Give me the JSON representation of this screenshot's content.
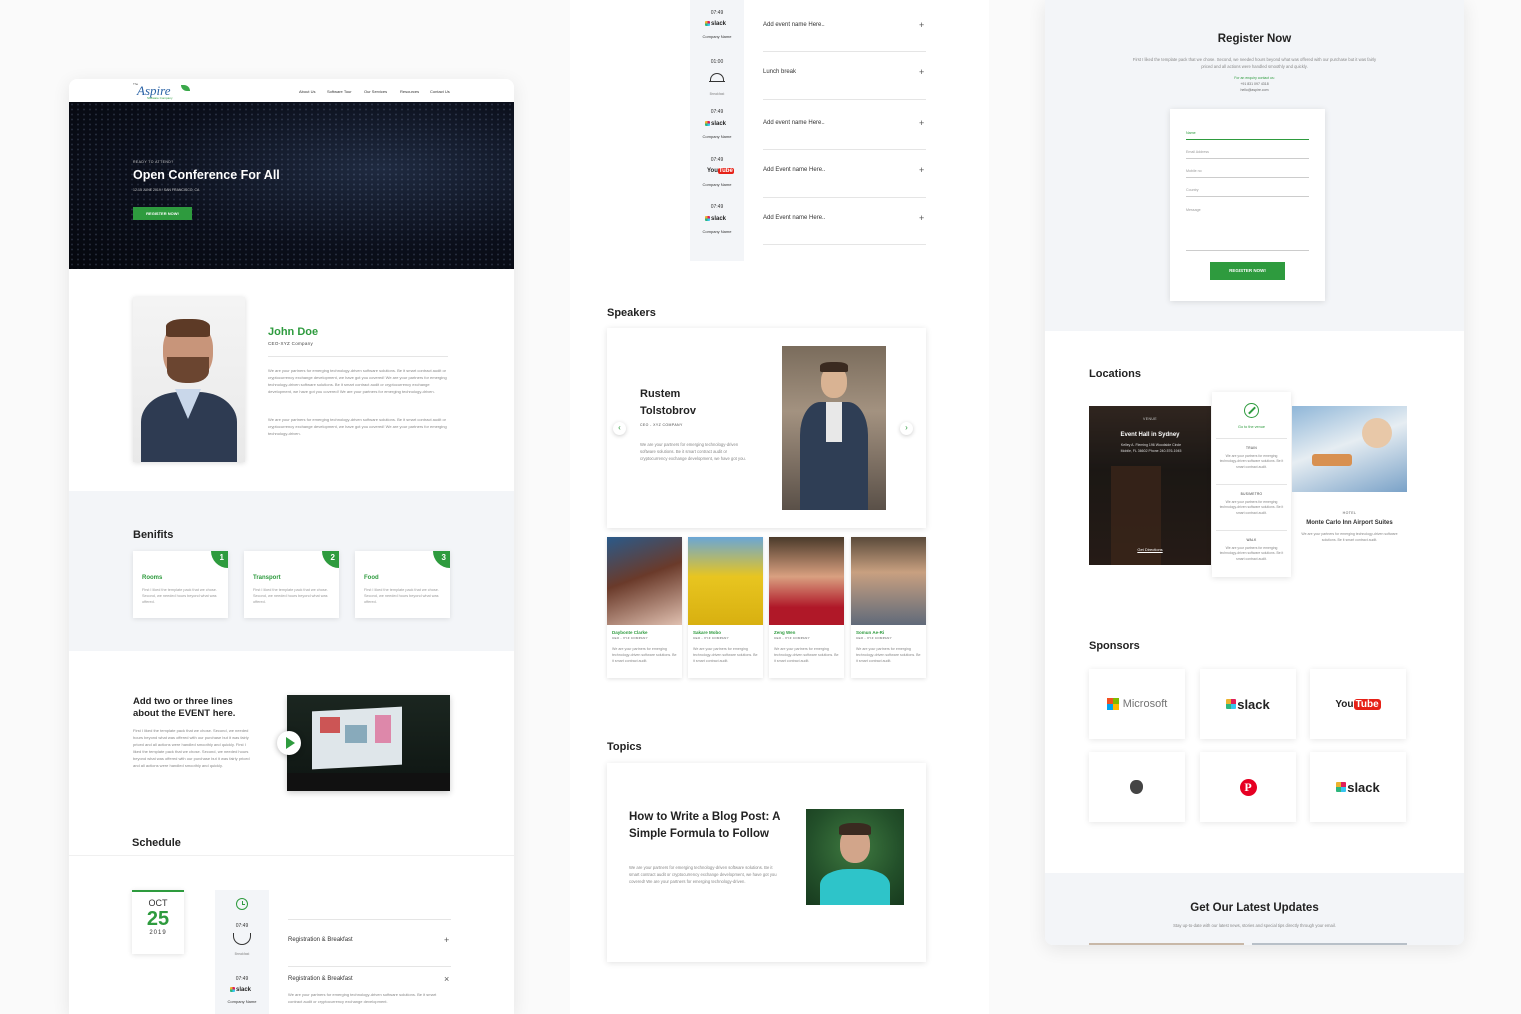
{
  "page1": {
    "logo_small": "The",
    "logo": "Aspire",
    "logo_tag": "Software Company",
    "nav": [
      "About Us",
      "Software Tour",
      "Our Services",
      "Resources",
      "Contact Us"
    ],
    "hero": {
      "eyebrow": "READY TO ATTEND?",
      "title": "Open Conference For All",
      "date": "12-15 JUNE 2019 / SAN FRANCISCO, CA",
      "button": "REGISTER NOW!"
    },
    "profile": {
      "name": "John Doe",
      "role": "CEO-XYZ Company",
      "para1": "We are your partners for emerging technology-driven software solutions. Be it smart contract audit or cryptocurrency exchange development, we have got you covered! We are your partners for emerging technology-driven software solutions. Be it smart contract audit or cryptocurrency exchange development, we have got you covered! We are your partners for emerging technology-driven.",
      "para2": "We are your partners for emerging technology-driven software solutions. Be it smart contract audit or cryptocurrency exchange development, we have got you covered! We are your partners for emerging technology-driven."
    },
    "benefits": {
      "title": "Benifits",
      "items": [
        {
          "num": "1",
          "title": "Rooms",
          "text": "First I liked the template pack that we chose. Second, we needed hours beyond what was offered."
        },
        {
          "num": "2",
          "title": "Transport",
          "text": "First I liked the template pack that we chose. Second, we needed hours beyond what was offered."
        },
        {
          "num": "3",
          "title": "Food",
          "text": "First I liked the template pack that we chose. Second, we needed hours beyond what was offered."
        }
      ]
    },
    "event": {
      "title": "Add two or three lines about the EVENT here.",
      "text": "First I liked the template pack that we chose. Second, we needed hours beyond what was offered with our purchase but it was fairly priced and all actions were handled smoothly and quickly. First I liked the template pack that we chose. Second, we needed hours beyond what was offered with our purchase but it was fairly priced and all actions were handled smoothly and quickly."
    },
    "schedule": {
      "title": "Schedule",
      "month": "OCT",
      "day": "25",
      "year": "2019",
      "rows": [
        {
          "time": "07:49",
          "caption": "Breakfast",
          "title": "Registration & Breakfast",
          "action": "+"
        },
        {
          "time": "07:49",
          "caption": "Company Name",
          "logo": "slack",
          "title": "Registration & Breakfast",
          "action": "×",
          "desc": "We are your partners for emerging technology-driven software solutions. Be it smart contract audit or cryptocurrency exchange development."
        }
      ]
    }
  },
  "page2": {
    "schedule_rows": [
      {
        "time": "07:49",
        "logo": "slack",
        "caption": "Company Name",
        "title": "Add event name Here..",
        "action": "+"
      },
      {
        "time": "01:00",
        "caption": "Breakfast",
        "title": "Lunch break",
        "action": "+"
      },
      {
        "time": "07:49",
        "logo": "slack",
        "caption": "Company Name",
        "title": "Add event name Here..",
        "action": "+"
      },
      {
        "time": "07:49",
        "logo": "YouTube",
        "caption": "Company Name",
        "title": "Add Event name Here..",
        "action": "+"
      },
      {
        "time": "07:49",
        "logo": "slack",
        "caption": "Company Name",
        "title": "Add Event name Here..",
        "action": "+"
      }
    ],
    "speakers": {
      "title": "Speakers",
      "featured": {
        "name_line1": "Rustem",
        "name_line2": "Tolstobrov",
        "role": "CEO - XYZ COMPANY",
        "text": "We are your partners for emerging technology-driven software solutions. Be it smart contract audit or cryptocurrency exchange development, we have got you."
      },
      "prev": "‹",
      "next": "›",
      "list": [
        {
          "name": "Daybonte Clarke",
          "role": "CEO - XYZ COMPANY",
          "text": "We are your partners for emerging technology-driven software solutions. Be it smart contract audit."
        },
        {
          "name": "Sakare Mobo",
          "role": "CEO - XYZ COMPANY",
          "text": "We are your partners for emerging technology-driven software solutions. Be it smart contract audit."
        },
        {
          "name": "Zeng Wen",
          "role": "CEO - XYZ COMPANY",
          "text": "We are your partners for emerging technology-driven software solutions. Be it smart contract audit."
        },
        {
          "name": "Somun Ae-Ri",
          "role": "CEO - XYZ COMPANY",
          "text": "We are your partners for emerging technology-driven software solutions. Be it smart contract audit."
        }
      ]
    },
    "topics": {
      "title": "Topics",
      "post_title": "How to Write a Blog Post: A Simple Formula to Follow",
      "post_text": "We are your partners for emerging technology-driven software solutions. Be it smart contract audit or cryptocurrency exchange development, we have got you covered! We are your partners for emerging technology-driven."
    }
  },
  "page3": {
    "register": {
      "title": "Register Now",
      "text": "First I liked the template pack that we chose. Second, we needed hours beyond what was offered with our purchase but it was fairly priced and all actions were handled smoothly and quickly.",
      "enquiry": "For an enquiry contact us:",
      "phone": "+91 831 097 4318",
      "email": "hello@aspire.com",
      "fields": [
        "Name",
        "Email Address",
        "Mobile no",
        "Country",
        "Message"
      ],
      "button": "REGISTER NOW!"
    },
    "locations": {
      "title": "Locations",
      "venue_label": "VENUE",
      "venue_title": "Event Hall in Sydney",
      "venue_address": "Kelley A. Fleming 196 Woodside Circle Mobile, FL 36602 Phone 240-576-1945",
      "venue_link": "Get Directions",
      "go_venue": "Go to the venue",
      "modes": [
        {
          "label": "TRAIN",
          "text": "We are your partners for emerging technology-driven software solutions. Be it smart contract audit."
        },
        {
          "label": "BUS/METRO",
          "text": "We are your partners for emerging technology-driven software solutions. Be it smart contract audit."
        },
        {
          "label": "WALK",
          "text": "We are your partners for emerging technology-driven software solutions. Be it smart contract audit."
        }
      ],
      "hotel_label": "HOTEL",
      "hotel_title": "Monte Carlo Inn Airport Suites",
      "hotel_text": "We are your partners for emerging technology-driven software solutions. Be it smart contract audit."
    },
    "sponsors": {
      "title": "Sponsors",
      "items": [
        "Microsoft",
        "slack",
        "YouTube",
        "apple",
        "pinterest",
        "slack"
      ]
    },
    "updates": {
      "title": "Get Our Latest Updates",
      "text": "Stay up-to-date with our latest news, stories and special tips directly through your email."
    }
  },
  "colors": {
    "accent": "#2e9b3e",
    "band": "#f3f5f8",
    "hero": "#0b0f1b"
  }
}
